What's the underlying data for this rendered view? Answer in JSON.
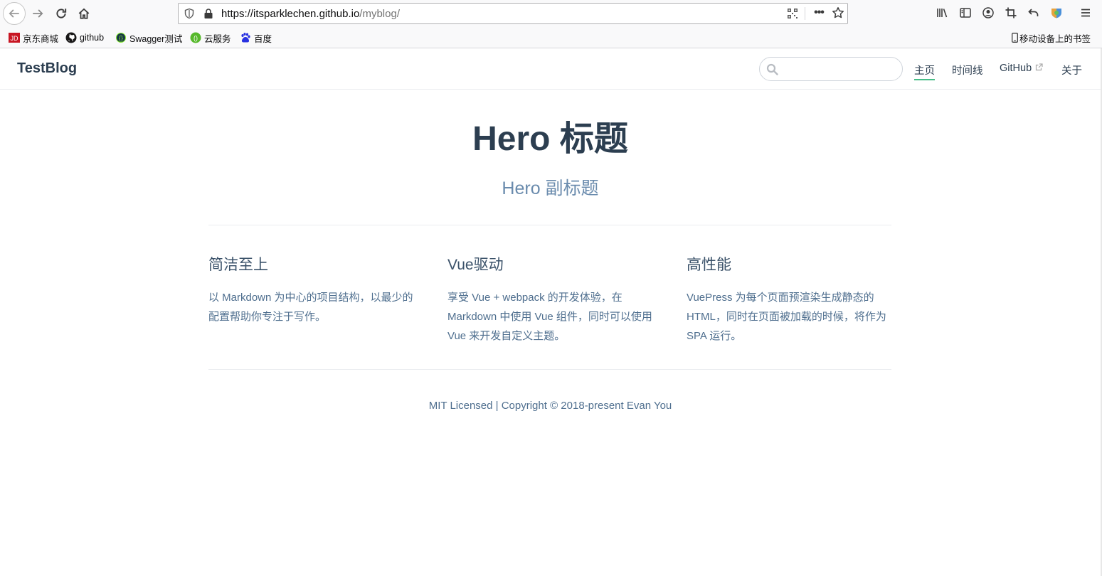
{
  "browser": {
    "url_host": "https://itsparklechen.github.io",
    "url_path": "/myblog/",
    "url_more_glyph": "•••",
    "bookmarks": [
      {
        "label": "京东商城",
        "icon": "jd-icon"
      },
      {
        "label": "github",
        "icon": "github-icon"
      },
      {
        "label": "Swagger测试",
        "icon": "swagger-icon"
      },
      {
        "label": "云服务",
        "icon": "cloud-service-icon"
      },
      {
        "label": "百度",
        "icon": "baidu-icon"
      }
    ],
    "mobile_bookmarks": "移动设备上的书签"
  },
  "site": {
    "title": "TestBlog",
    "search_placeholder": "",
    "nav": [
      {
        "label": "主页",
        "active": true
      },
      {
        "label": "时间线",
        "active": false
      },
      {
        "label": "GitHub",
        "active": false,
        "external": true
      },
      {
        "label": "关于",
        "active": false
      }
    ]
  },
  "hero": {
    "title": "Hero 标题",
    "subtitle": "Hero 副标题"
  },
  "features": [
    {
      "title": "简洁至上",
      "details": "以 Markdown 为中心的项目结构，以最少的配置帮助你专注于写作。"
    },
    {
      "title": "Vue驱动",
      "details": "享受 Vue + webpack 的开发体验，在 Markdown 中使用 Vue 组件，同时可以使用 Vue 来开发自定义主题。"
    },
    {
      "title": "高性能",
      "details": "VuePress 为每个页面预渲染生成静态的 HTML，同时在页面被加载的时候，将作为 SPA 运行。"
    }
  ],
  "footer": "MIT Licensed | Copyright © 2018-present Evan You",
  "colors": {
    "accent": "#46bd87",
    "text": "#2c3e50",
    "subtitle": "#6a8bad"
  }
}
